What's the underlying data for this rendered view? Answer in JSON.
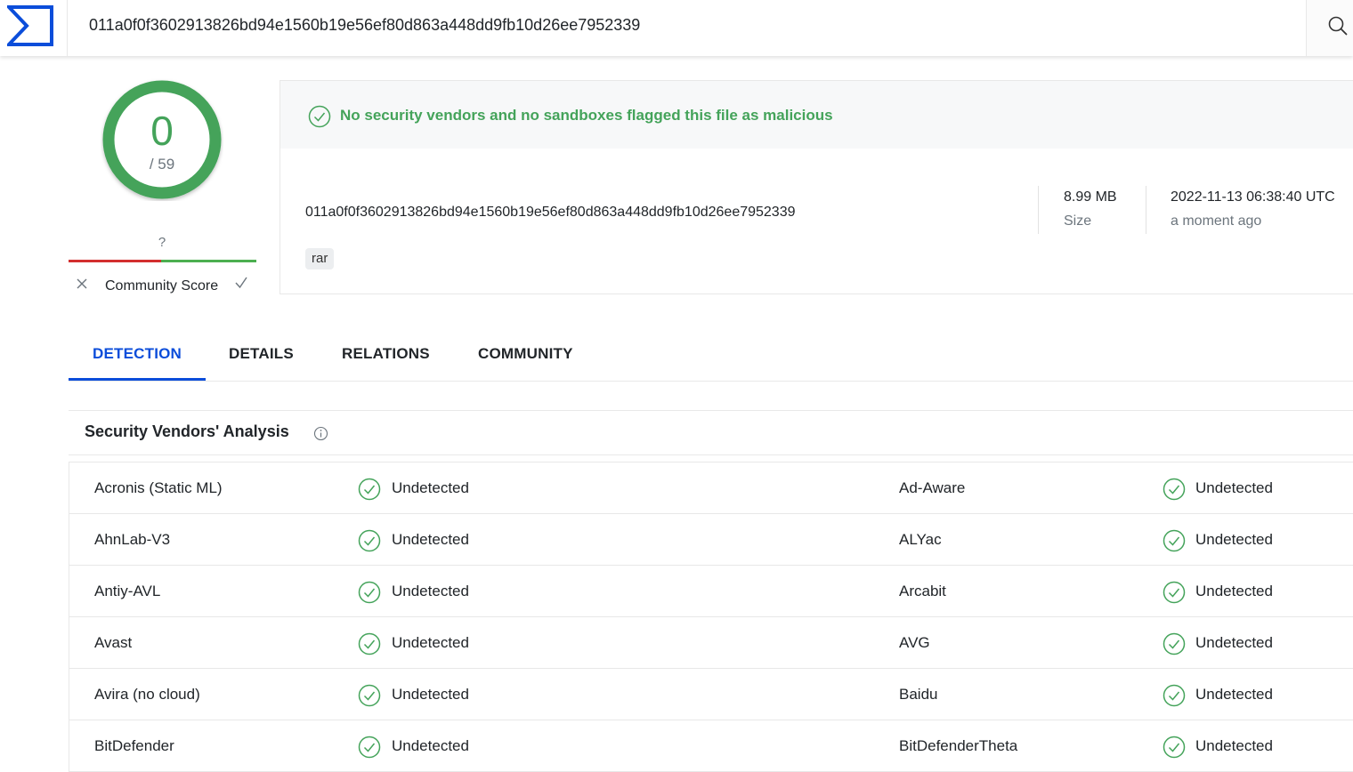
{
  "search": {
    "value": "011a0f0f3602913826bd94e1560b19e56ef80d863a448dd9fb10d26ee7952339"
  },
  "score": {
    "detections": "0",
    "total": "/ 59"
  },
  "community": {
    "question": "?",
    "label": "Community Score"
  },
  "summary": {
    "banner": "No security vendors and no sandboxes flagged this file as malicious",
    "hash": "011a0f0f3602913826bd94e1560b19e56ef80d863a448dd9fb10d26ee7952339",
    "tag": "rar",
    "size_value": "8.99 MB",
    "size_label": "Size",
    "date_value": "2022-11-13 06:38:40 UTC",
    "date_relative": "a moment ago"
  },
  "tabs": [
    {
      "label": "DETECTION"
    },
    {
      "label": "DETAILS"
    },
    {
      "label": "RELATIONS"
    },
    {
      "label": "COMMUNITY"
    }
  ],
  "analysis": {
    "title": "Security Vendors' Analysis"
  },
  "vendors": [
    {
      "left": "Acronis (Static ML)",
      "left_result": "Undetected",
      "right": "Ad-Aware",
      "right_result": "Undetected"
    },
    {
      "left": "AhnLab-V3",
      "left_result": "Undetected",
      "right": "ALYac",
      "right_result": "Undetected"
    },
    {
      "left": "Antiy-AVL",
      "left_result": "Undetected",
      "right": "Arcabit",
      "right_result": "Undetected"
    },
    {
      "left": "Avast",
      "left_result": "Undetected",
      "right": "AVG",
      "right_result": "Undetected"
    },
    {
      "left": "Avira (no cloud)",
      "left_result": "Undetected",
      "right": "Baidu",
      "right_result": "Undetected"
    },
    {
      "left": "BitDefender",
      "left_result": "Undetected",
      "right": "BitDefenderTheta",
      "right_result": "Undetected"
    }
  ],
  "colors": {
    "accent": "#0b4dda",
    "clean": "#44a35a",
    "negative": "#d32f2f",
    "logo": "#0b4dda"
  },
  "icons": {
    "logo": "virustotal-logo-icon",
    "search": "search-icon",
    "clean": "check-circle-icon",
    "info": "info-icon",
    "downvote": "close-icon",
    "upvote": "check-icon"
  }
}
